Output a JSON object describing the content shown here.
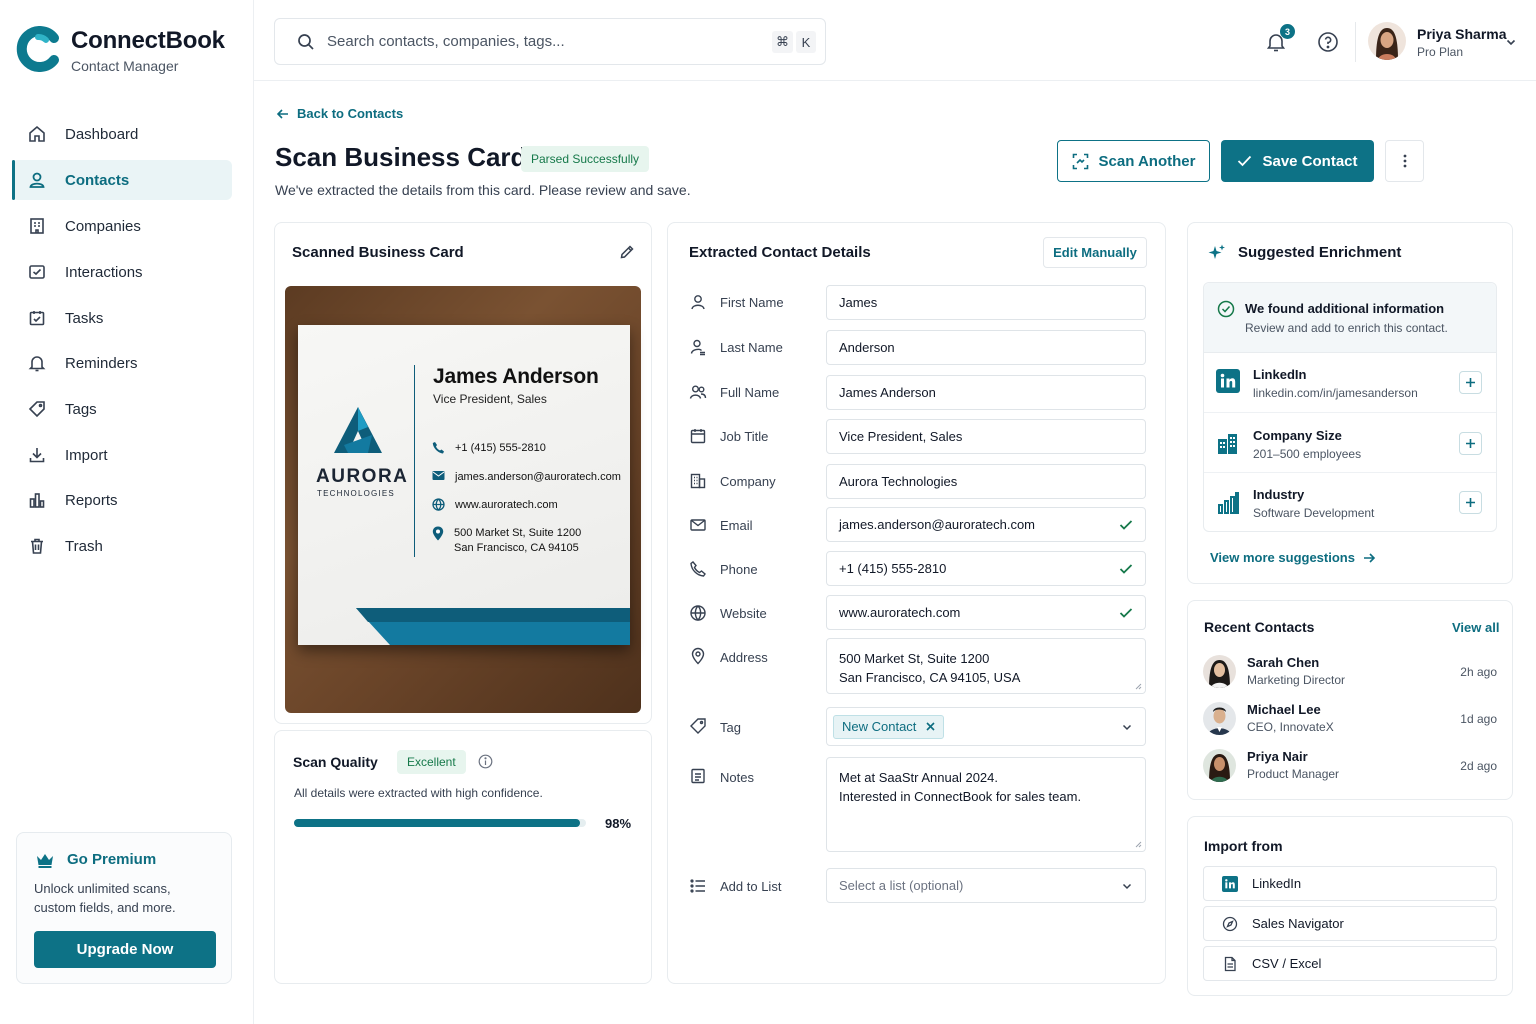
{
  "app": {
    "name": "ConnectBook",
    "subtitle": "Contact Manager"
  },
  "nav": {
    "items": [
      {
        "label": "Dashboard",
        "icon": "home-icon"
      },
      {
        "label": "Contacts",
        "icon": "user-icon"
      },
      {
        "label": "Companies",
        "icon": "building-icon"
      },
      {
        "label": "Interactions",
        "icon": "message-icon"
      },
      {
        "label": "Tasks",
        "icon": "task-icon"
      },
      {
        "label": "Reminders",
        "icon": "bell-icon"
      },
      {
        "label": "Tags",
        "icon": "tag-icon"
      },
      {
        "label": "Import",
        "icon": "download-icon"
      },
      {
        "label": "Reports",
        "icon": "bar-chart-icon"
      },
      {
        "label": "Trash",
        "icon": "trash-icon"
      }
    ],
    "active": "Contacts"
  },
  "premium": {
    "title": "Go Premium",
    "text": "Unlock unlimited scans, custom fields, and more.",
    "button": "Upgrade Now"
  },
  "search": {
    "placeholder": "Search contacts, companies, tags...",
    "shortcut_mod": "⌘",
    "shortcut_key": "K"
  },
  "notifications": {
    "count": "3"
  },
  "user": {
    "name": "Priya Sharma",
    "plan": "Pro Plan"
  },
  "header": {
    "back": "Back to Contacts",
    "title": "Scan Business Card",
    "status": "Parsed Successfully",
    "subtitle": "We've extracted the details from this card. Please review and save.",
    "scan_another": "Scan Another",
    "save_contact": "Save Contact"
  },
  "scanned": {
    "title": "Scanned Business Card",
    "card": {
      "name": "James Anderson",
      "role": "Vice President, Sales",
      "phone": "+1 (415) 555-2810",
      "email": "james.anderson@auroratech.com",
      "website": "www.auroratech.com",
      "address1": "500 Market St, Suite 1200",
      "address2": "San Francisco, CA 94105",
      "brand": "AURORA",
      "brand_sub": "TECHNOLOGIES"
    }
  },
  "quality": {
    "title": "Scan Quality",
    "badge": "Excellent",
    "text": "All details were extracted with high confidence.",
    "percent_label": "98%",
    "value": 0.98
  },
  "extracted": {
    "title": "Extracted Contact Details",
    "edit": "Edit Manually",
    "fields": {
      "first_name": {
        "label": "First Name",
        "value": "James"
      },
      "last_name": {
        "label": "Last Name",
        "value": "Anderson"
      },
      "full_name": {
        "label": "Full Name",
        "value": "James Anderson"
      },
      "job_title": {
        "label": "Job Title",
        "value": "Vice President, Sales"
      },
      "company": {
        "label": "Company",
        "value": "Aurora Technologies"
      },
      "email": {
        "label": "Email",
        "value": "james.anderson@auroratech.com"
      },
      "phone": {
        "label": "Phone",
        "value": "+1 (415) 555-2810"
      },
      "website": {
        "label": "Website",
        "value": "www.auroratech.com"
      },
      "address": {
        "label": "Address",
        "value": "500 Market St, Suite 1200\nSan Francisco, CA 94105, USA"
      },
      "tag": {
        "label": "Tag",
        "value": "New Contact"
      },
      "notes": {
        "label": "Notes",
        "value": "Met at SaaStr Annual 2024.\nInterested in ConnectBook for sales team."
      },
      "list": {
        "label": "Add to List",
        "placeholder": "Select a list (optional)"
      }
    }
  },
  "enrichment": {
    "title": "Suggested Enrichment",
    "found_title": "We found additional information",
    "found_text": "Review and add to enrich this contact.",
    "items": [
      {
        "title": "LinkedIn",
        "value": "linkedin.com/in/jamesanderson"
      },
      {
        "title": "Company Size",
        "value": "201–500 employees"
      },
      {
        "title": "Industry",
        "value": "Software Development"
      }
    ],
    "more": "View more suggestions"
  },
  "recent": {
    "title": "Recent Contacts",
    "view_all": "View all",
    "items": [
      {
        "name": "Sarah Chen",
        "role": "Marketing Director",
        "time": "2h ago"
      },
      {
        "name": "Michael Lee",
        "role": "CEO, InnovateX",
        "time": "1d ago"
      },
      {
        "name": "Priya Nair",
        "role": "Product Manager",
        "time": "2d ago"
      }
    ]
  },
  "import": {
    "title": "Import from",
    "items": [
      {
        "label": "LinkedIn"
      },
      {
        "label": "Sales Navigator"
      },
      {
        "label": "CSV / Excel"
      }
    ]
  },
  "colors": {
    "accent": "#0d7286",
    "success": "#16794a",
    "text": "#111827"
  }
}
